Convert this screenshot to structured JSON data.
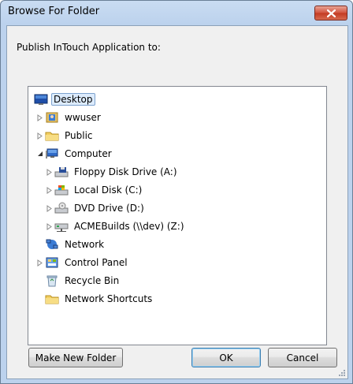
{
  "window": {
    "title": "Browse For Folder"
  },
  "prompt": "Publish InTouch Application to:",
  "tree": [
    {
      "label": "Desktop",
      "icon": "desktop-icon",
      "expander": "none",
      "selected": true
    },
    {
      "label": "wwuser",
      "icon": "user-folder-icon",
      "expander": "collapsed"
    },
    {
      "label": "Public",
      "icon": "folder-icon",
      "expander": "collapsed"
    },
    {
      "label": "Computer",
      "icon": "computer-icon",
      "expander": "expanded"
    },
    {
      "label": "Floppy Disk Drive (A:)",
      "icon": "floppy-drive-icon",
      "expander": "collapsed"
    },
    {
      "label": "Local Disk (C:)",
      "icon": "local-disk-icon",
      "expander": "collapsed"
    },
    {
      "label": "DVD Drive (D:)",
      "icon": "dvd-drive-icon",
      "expander": "collapsed"
    },
    {
      "label": "ACMEBuilds (\\\\dev) (Z:)",
      "icon": "network-drive-icon",
      "expander": "collapsed"
    },
    {
      "label": "Network",
      "icon": "network-icon",
      "expander": "none"
    },
    {
      "label": "Control Panel",
      "icon": "control-panel-icon",
      "expander": "collapsed"
    },
    {
      "label": "Recycle Bin",
      "icon": "recycle-bin-icon",
      "expander": "none"
    },
    {
      "label": "Network Shortcuts",
      "icon": "folder-icon",
      "expander": "none"
    }
  ],
  "buttons": {
    "make_new_folder": "Make New Folder",
    "ok": "OK",
    "cancel": "Cancel"
  },
  "colors": {
    "selection": "#dcebfc",
    "close": "#c9432c"
  }
}
